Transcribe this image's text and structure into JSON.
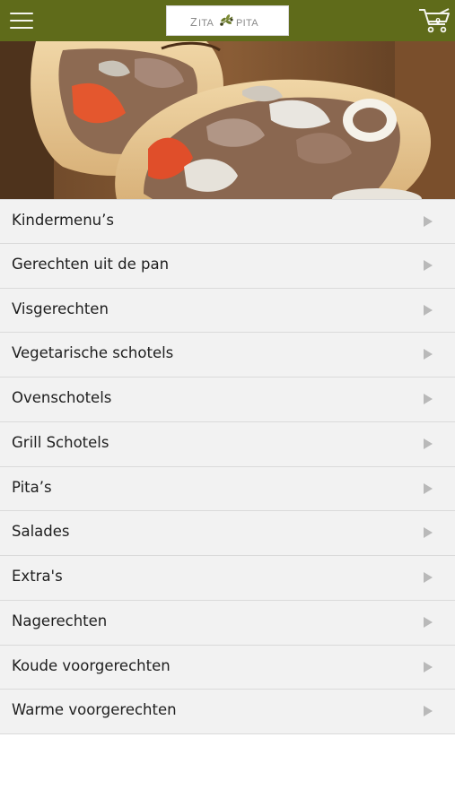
{
  "header": {
    "menu_icon": "hamburger-icon",
    "logo_text": "ZITAKIPITA",
    "cart_icon": "shopping-cart-icon",
    "cart_count": "0",
    "bar_color": "#5f6b1a"
  },
  "hero": {
    "image": "gyros-pita-photo"
  },
  "menu": {
    "arrow_icon": "triangle-right-icon",
    "items": [
      {
        "label": "Kindermenu’s"
      },
      {
        "label": "Gerechten uit de pan"
      },
      {
        "label": "Visgerechten"
      },
      {
        "label": "Vegetarische schotels"
      },
      {
        "label": "Ovenschotels"
      },
      {
        "label": "Grill Schotels"
      },
      {
        "label": "Pita’s"
      },
      {
        "label": "Salades"
      },
      {
        "label": "Extra's"
      },
      {
        "label": "Nagerechten"
      },
      {
        "label": "Koude voorgerechten"
      },
      {
        "label": "Warme voorgerechten"
      }
    ]
  }
}
